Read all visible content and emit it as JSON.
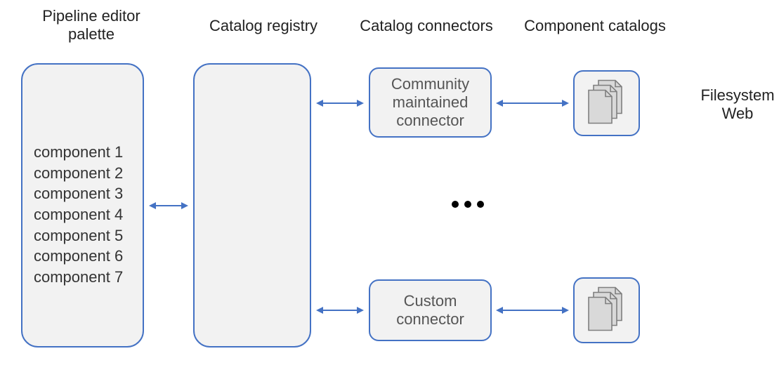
{
  "headings": {
    "palette": "Pipeline editor\npalette",
    "registry": "Catalog registry",
    "connectors": "Catalog connectors",
    "catalogs": "Component catalogs"
  },
  "palette": {
    "items": [
      "component 1",
      "component 2",
      "component 3",
      "component 4",
      "component 5",
      "component 6",
      "component 7"
    ]
  },
  "connectors": {
    "community": "Community\nmaintained\nconnector",
    "custom": "Custom\nconnector"
  },
  "side_text": "Filesystem\nWeb",
  "ellipsis_label": "…",
  "colors": {
    "border": "#4472C4",
    "box_fill": "#F2F2F2",
    "arrow": "#4472C4",
    "doc_fill": "#D9D9D9",
    "doc_stroke": "#7F7F7F"
  }
}
